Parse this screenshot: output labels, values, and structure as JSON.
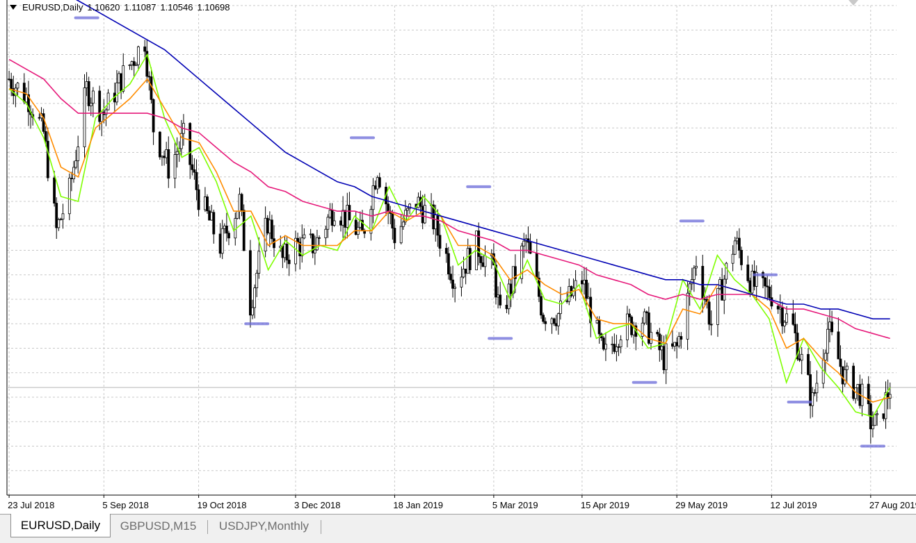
{
  "header": {
    "symbol": "EURUSD,Daily",
    "open": "1.10620",
    "high": "1.11087",
    "low": "1.10546",
    "close": "1.10698"
  },
  "tabs": [
    {
      "label": "EURUSD,Daily",
      "active": true
    },
    {
      "label": "GBPUSD,M15",
      "active": false
    },
    {
      "label": "USDJPY,Monthly",
      "active": false
    }
  ],
  "colors": {
    "ma_fast": "#7fff00",
    "ma_medium": "#ff8c00",
    "ma_slow": "#e6197a",
    "ma_long": "#0000b4",
    "candle": "#000000",
    "grid": "#c8c8c8",
    "fractal_label": "#6a6ad8"
  },
  "chart_data": {
    "type": "candlestick",
    "x_ticks": [
      "23 Jul 2018",
      "5 Sep 2018",
      "19 Oct 2018",
      "3 Dec 2018",
      "18 Jan 2019",
      "5 Mar 2019",
      "15 Apr 2019",
      "29 May 2019",
      "12 Jul 2019",
      "27 Aug 2019"
    ],
    "y_range": [
      1.085,
      1.185
    ],
    "grid": true,
    "last_price": 1.10698,
    "close_path": [
      [
        "23 Jul 2018",
        1.17
      ],
      [
        "1 Aug 2018",
        1.166
      ],
      [
        "8 Aug 2018",
        1.159
      ],
      [
        "14 Aug 2018",
        1.139
      ],
      [
        "20 Aug 2018",
        1.147
      ],
      [
        "28 Aug 2018",
        1.168
      ],
      [
        "5 Sep 2018",
        1.163
      ],
      [
        "13 Sep 2018",
        1.17
      ],
      [
        "24 Sep 2018",
        1.178
      ],
      [
        "28 Sep 2018",
        1.16
      ],
      [
        "5 Oct 2018",
        1.152
      ],
      [
        "12 Oct 2018",
        1.158
      ],
      [
        "19 Oct 2018",
        1.146
      ],
      [
        "29 Oct 2018",
        1.136
      ],
      [
        "7 Nov 2018",
        1.145
      ],
      [
        "12 Nov 2018",
        1.124
      ],
      [
        "20 Nov 2018",
        1.141
      ],
      [
        "27 Nov 2018",
        1.133
      ],
      [
        "3 Dec 2018",
        1.136
      ],
      [
        "12 Dec 2018",
        1.136
      ],
      [
        "21 Dec 2018",
        1.144
      ],
      [
        "3 Jan 2019",
        1.138
      ],
      [
        "10 Jan 2019",
        1.152
      ],
      [
        "18 Jan 2019",
        1.138
      ],
      [
        "28 Jan 2019",
        1.145
      ],
      [
        "5 Feb 2019",
        1.141
      ],
      [
        "15 Feb 2019",
        1.129
      ],
      [
        "25 Feb 2019",
        1.136
      ],
      [
        "5 Mar 2019",
        1.131
      ],
      [
        "8 Mar 2019",
        1.121
      ],
      [
        "20 Mar 2019",
        1.137
      ],
      [
        "28 Mar 2019",
        1.122
      ],
      [
        "4 Apr 2019",
        1.122
      ],
      [
        "15 Apr 2019",
        1.129
      ],
      [
        "25 Apr 2019",
        1.113
      ],
      [
        "3 May 2019",
        1.119
      ],
      [
        "13 May 2019",
        1.121
      ],
      [
        "23 May 2019",
        1.113
      ],
      [
        "29 May 2019",
        1.115
      ],
      [
        "7 Jun 2019",
        1.133
      ],
      [
        "14 Jun 2019",
        1.12
      ],
      [
        "25 Jun 2019",
        1.137
      ],
      [
        "3 Jul 2019",
        1.128
      ],
      [
        "12 Jul 2019",
        1.126
      ],
      [
        "22 Jul 2019",
        1.119
      ],
      [
        "31 Jul 2019",
        1.104
      ],
      [
        "7 Aug 2019",
        1.119
      ],
      [
        "15 Aug 2019",
        1.109
      ],
      [
        "22 Aug 2019",
        1.106
      ],
      [
        "27 Aug 2019",
        1.1
      ],
      [
        "30 Aug 2019",
        1.099
      ],
      [
        "5 Sep 2019",
        1.107
      ]
    ],
    "series": [
      {
        "role": "ma_fast",
        "values": [
          1.168,
          1.165,
          1.158,
          1.146,
          1.145,
          1.162,
          1.166,
          1.169,
          1.175,
          1.162,
          1.154,
          1.156,
          1.149,
          1.139,
          1.142,
          1.131,
          1.137,
          1.134,
          1.136,
          1.135,
          1.142,
          1.139,
          1.148,
          1.141,
          1.146,
          1.142,
          1.132,
          1.135,
          1.133,
          1.125,
          1.133,
          1.125,
          1.124,
          1.128,
          1.117,
          1.119,
          1.12,
          1.115,
          1.116,
          1.129,
          1.123,
          1.134,
          1.129,
          1.126,
          1.121,
          1.108,
          1.117,
          1.111,
          1.107,
          1.102,
          1.101,
          1.107
        ]
      },
      {
        "role": "ma_medium",
        "values": [
          1.168,
          1.167,
          1.162,
          1.152,
          1.15,
          1.16,
          1.163,
          1.166,
          1.17,
          1.164,
          1.158,
          1.157,
          1.151,
          1.143,
          1.143,
          1.136,
          1.138,
          1.136,
          1.136,
          1.136,
          1.139,
          1.139,
          1.143,
          1.141,
          1.143,
          1.142,
          1.136,
          1.136,
          1.134,
          1.129,
          1.131,
          1.128,
          1.126,
          1.127,
          1.121,
          1.12,
          1.12,
          1.117,
          1.116,
          1.123,
          1.122,
          1.128,
          1.127,
          1.126,
          1.123,
          1.115,
          1.117,
          1.113,
          1.11,
          1.106,
          1.104,
          1.105
        ]
      },
      {
        "role": "ma_slow",
        "values": [
          1.174,
          1.172,
          1.17,
          1.166,
          1.163,
          1.163,
          1.163,
          1.163,
          1.163,
          1.162,
          1.16,
          1.159,
          1.156,
          1.153,
          1.151,
          1.148,
          1.147,
          1.145,
          1.144,
          1.143,
          1.143,
          1.142,
          1.143,
          1.142,
          1.142,
          1.141,
          1.139,
          1.138,
          1.137,
          1.135,
          1.135,
          1.134,
          1.133,
          1.132,
          1.13,
          1.129,
          1.128,
          1.126,
          1.125,
          1.126,
          1.125,
          1.126,
          1.126,
          1.126,
          1.125,
          1.123,
          1.123,
          1.122,
          1.121,
          1.119,
          1.118,
          1.117
        ]
      },
      {
        "role": "ma_long",
        "values": [
          1.195,
          1.193,
          1.191,
          1.188,
          1.186,
          1.184,
          1.182,
          1.18,
          1.178,
          1.176,
          1.173,
          1.17,
          1.167,
          1.164,
          1.161,
          1.158,
          1.155,
          1.153,
          1.151,
          1.149,
          1.148,
          1.146,
          1.145,
          1.144,
          1.143,
          1.142,
          1.141,
          1.14,
          1.139,
          1.138,
          1.137,
          1.136,
          1.135,
          1.134,
          1.133,
          1.132,
          1.131,
          1.13,
          1.129,
          1.129,
          1.128,
          1.128,
          1.127,
          1.126,
          1.125,
          1.124,
          1.124,
          1.123,
          1.123,
          1.122,
          1.121,
          1.121
        ]
      }
    ]
  }
}
